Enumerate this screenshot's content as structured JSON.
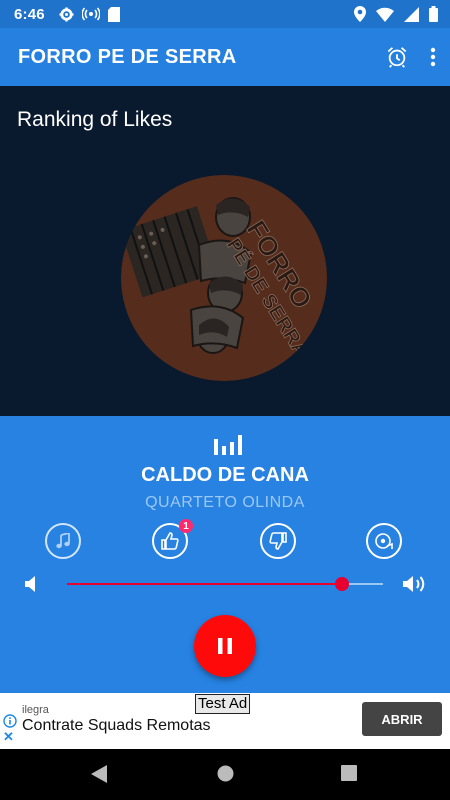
{
  "status_bar": {
    "time": "6:46"
  },
  "app_bar": {
    "title": "FORRO PE DE SERRA"
  },
  "hero": {
    "label": "Ranking of Likes",
    "artwork_text": "FORRO PÉ DE SERRA"
  },
  "player": {
    "title": "CALDO DE CANA",
    "artist": "QUARTETO OLINDA",
    "like_count": "1",
    "volume_level": 0.87,
    "state": "playing"
  },
  "ad": {
    "tag": "Test Ad",
    "advertiser": "ilegra",
    "headline": "Contrate Squads Remotas",
    "cta": "ABRIR"
  },
  "colors": {
    "primary": "#2580e0",
    "status_bar": "#1f73ca",
    "accent": "#ff0a0a",
    "hero_bg": "#0a1a2e"
  }
}
